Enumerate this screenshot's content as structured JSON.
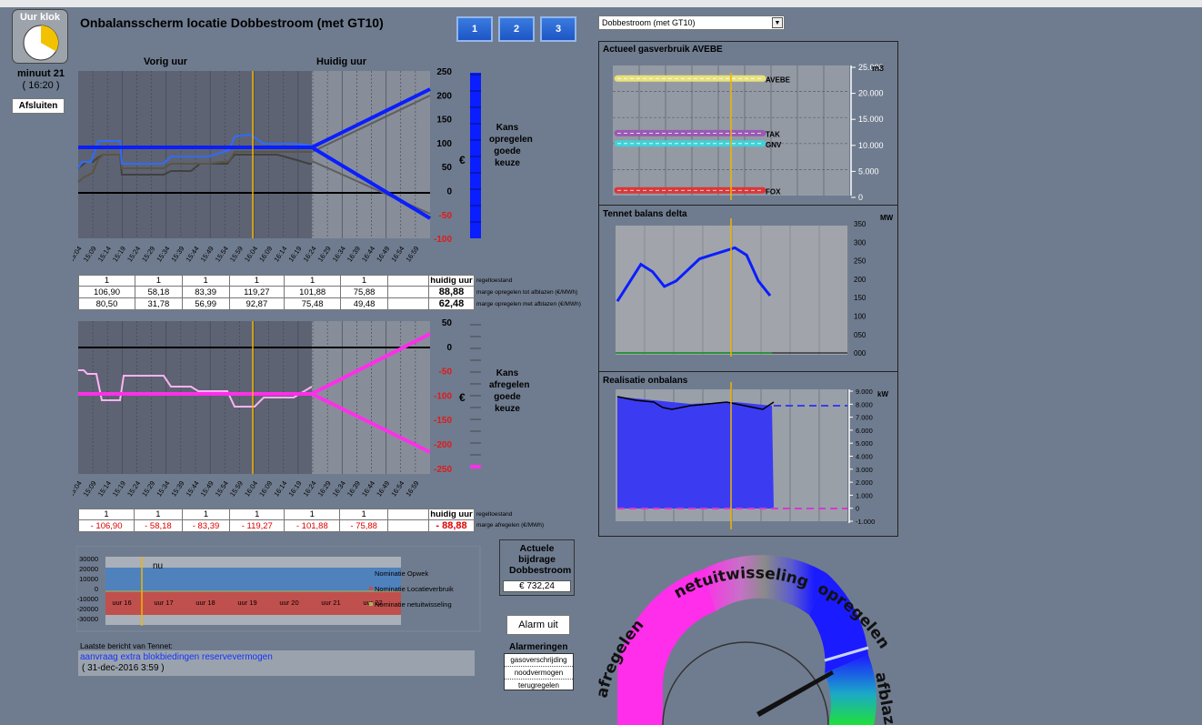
{
  "clock": {
    "title": "Uur klok",
    "minute": "minuut 21",
    "time": "( 16:20 )",
    "close_label": "Afsluiten"
  },
  "header": {
    "title": "Onbalansscherm locatie Dobbestroom (met GT10)",
    "buttons": [
      "1",
      "2",
      "3"
    ],
    "location_select": "Dobbestroom (met GT10)"
  },
  "chart1": {
    "left_label": "Vorig uur",
    "right_label": "Huidig uur",
    "yticks": [
      "250",
      "200",
      "150",
      "100",
      "50",
      "0",
      "-50",
      "-100"
    ],
    "unit": "€",
    "side_label": [
      "Kans",
      "opregelen",
      "goede",
      "keuze"
    ]
  },
  "chart2": {
    "yticks": [
      "50",
      "0",
      "-50",
      "-100",
      "-150",
      "-200",
      "-250"
    ],
    "unit": "€",
    "side_label": [
      "Kans",
      "afregelen",
      "goede",
      "keuze"
    ]
  },
  "xticks": [
    "15:04",
    "15:09",
    "15:14",
    "15:19",
    "15:24",
    "15:29",
    "15:34",
    "15:39",
    "15:44",
    "15:49",
    "15:54",
    "15:59",
    "16:04",
    "16:09",
    "16:14",
    "16:19",
    "16:24",
    "16:29",
    "16:34",
    "16:39",
    "16:44",
    "16:49",
    "16:54",
    "16:59"
  ],
  "table1": {
    "header": "huidig uur",
    "rows": [
      {
        "cells": [
          "1",
          "1",
          "1",
          "1",
          "1",
          "1"
        ],
        "current": "",
        "label": "regeltoestand"
      },
      {
        "cells": [
          "106,90",
          "58,18",
          "83,39",
          "119,27",
          "101,88",
          "75,88"
        ],
        "current": "88,88",
        "label": "marge opregelen tot afblazen (€/MWh)"
      },
      {
        "cells": [
          "80,50",
          "31,78",
          "56,99",
          "92,87",
          "75,48",
          "49,48"
        ],
        "current": "62,48",
        "label": "marge opregelen met afblazen (€/MWh)"
      }
    ]
  },
  "table2": {
    "header": "huidig uur",
    "rows": [
      {
        "cells": [
          "1",
          "1",
          "1",
          "1",
          "1",
          "1"
        ],
        "current": "",
        "label": "regeltoestand"
      },
      {
        "cells": [
          "- 106,90",
          "- 58,18",
          "- 83,39",
          "- 119,27",
          "- 101,88",
          "- 75,88"
        ],
        "current": "- 88,88",
        "label": "marge afregelen (€/MWh)"
      }
    ]
  },
  "nomination": {
    "yticks": [
      "30000",
      "20000",
      "10000",
      "0",
      "-10000",
      "-20000",
      "-30000"
    ],
    "now_label": "nu",
    "hours": [
      "uur 16",
      "uur 17",
      "uur 18",
      "uur 19",
      "uur 20",
      "uur 21",
      "uur 22"
    ],
    "legend": [
      "Nominatie Opwek",
      "Nominatie Locatieverbruik",
      "Nominatie netuitwisseling"
    ],
    "colors": [
      "#4f81bd",
      "#c0504d",
      "#9bbb59"
    ]
  },
  "message": {
    "label": "Laatste bericht van Tennet:",
    "text": "aanvraag extra blokbiedingen reservevermogen",
    "date": "( 31-dec-2016 3:59 )"
  },
  "contribution": {
    "title": "Actuele bijdrage Dobbestroom",
    "value": "€ 732,24"
  },
  "alarm": {
    "button": "Alarm uit",
    "title": "Alarmeringen",
    "items": [
      "gasoverschrijding",
      "noodvermogen",
      "terugregelen"
    ]
  },
  "gas": {
    "title": "Actueel gasverbruik AVEBE",
    "unit": "m3",
    "yticks": [
      "25.000",
      "20.000",
      "15.000",
      "10.000",
      "5.000",
      "0"
    ],
    "series": [
      {
        "name": "AVEBE",
        "value": 22500,
        "color": "#e8e27a"
      },
      {
        "name": "TAK",
        "value": 12000,
        "color": "#9a59b5"
      },
      {
        "name": "GNV",
        "value": 10000,
        "color": "#3fd1d8"
      },
      {
        "name": "FOX",
        "value": 1000,
        "color": "#d9383a"
      }
    ]
  },
  "tennet": {
    "title": "Tennet balans delta",
    "unit": "MW",
    "yticks": [
      "350",
      "300",
      "250",
      "200",
      "150",
      "100",
      "050",
      "000"
    ],
    "values": [
      145,
      195,
      245,
      225,
      185,
      200,
      230,
      260,
      270,
      280,
      290,
      270,
      200,
      160
    ]
  },
  "realisatie": {
    "title": "Realisatie onbalans",
    "unit": "kW",
    "yticks": [
      "9.000",
      "8.000",
      "7.000",
      "6.000",
      "5.000",
      "4.000",
      "3.000",
      "2.000",
      "1.000",
      "0",
      "-1.000"
    ]
  },
  "gauge": {
    "labels": [
      "afregelen",
      "netuitwisseling",
      "opregelen",
      "afblazen"
    ],
    "colors": {
      "afregelen": "#ff2eea",
      "netuitwisseling": "#8a8a8a",
      "opregelen": "#1b1bff",
      "afblazen": "#1fe03a"
    }
  }
}
